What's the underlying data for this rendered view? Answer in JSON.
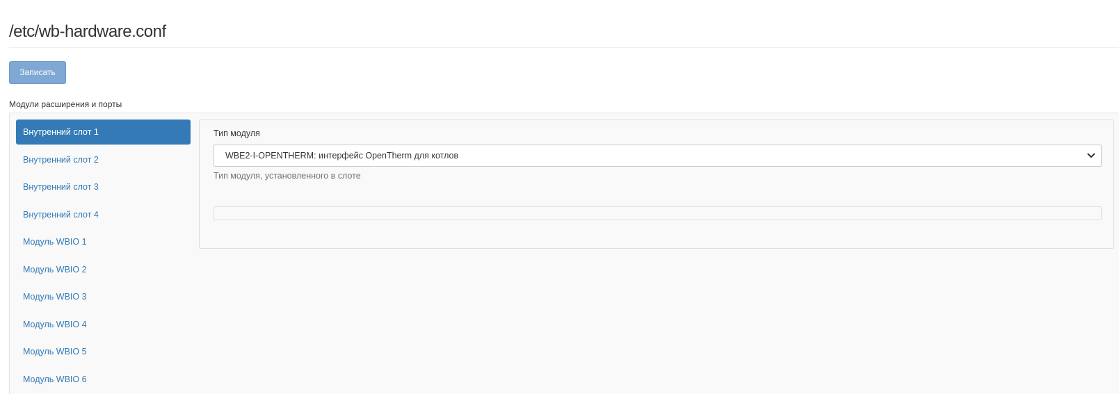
{
  "page": {
    "title": "/etc/wb-hardware.conf"
  },
  "toolbar": {
    "save_label": "Записать"
  },
  "section": {
    "label": "Модули расширения и порты"
  },
  "sidebar": {
    "items": [
      {
        "label": "Внутренний слот 1",
        "active": true
      },
      {
        "label": "Внутренний слот 2",
        "active": false
      },
      {
        "label": "Внутренний слот 3",
        "active": false
      },
      {
        "label": "Внутренний слот 4",
        "active": false
      },
      {
        "label": "Модуль WBIO 1",
        "active": false
      },
      {
        "label": "Модуль WBIO 2",
        "active": false
      },
      {
        "label": "Модуль WBIO 3",
        "active": false
      },
      {
        "label": "Модуль WBIO 4",
        "active": false
      },
      {
        "label": "Модуль WBIO 5",
        "active": false
      },
      {
        "label": "Модуль WBIO 6",
        "active": false
      }
    ]
  },
  "panel": {
    "module_type_label": "Тип модуля",
    "module_type_value": "WBE2-I-OPENTHERM: интерфейс OpenTherm для котлов",
    "module_type_help": "Тип модуля, установленного в слоте"
  },
  "colors": {
    "accent": "#337ab7",
    "button_disabled": "#7fa8d4",
    "panel_bg": "#f9f9f9"
  },
  "icons": {
    "select_arrow": "chevron-down-icon"
  }
}
